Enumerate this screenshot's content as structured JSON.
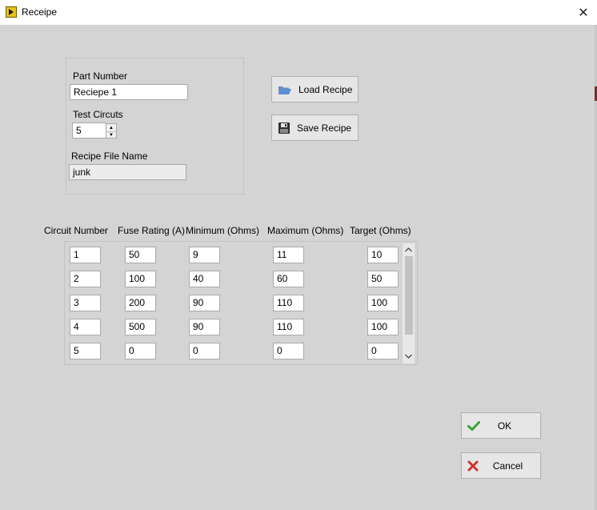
{
  "window": {
    "title": "Receipe",
    "close_glyph": "✕"
  },
  "part_number": {
    "label": "Part Number",
    "value": "Reciepe 1"
  },
  "test_circuits": {
    "label": "Test Circuts",
    "value": "5"
  },
  "recipe_file": {
    "label": "Recipe File Name",
    "value": "junk"
  },
  "buttons": {
    "load": "Load Recipe",
    "save": "Save Recipe",
    "ok": "OK",
    "cancel": "Cancel"
  },
  "table": {
    "headers": [
      "Circuit Number",
      "Fuse Rating (A)",
      "Minimum (Ohms)",
      "Maximum (Ohms)",
      "Target (Ohms)"
    ],
    "rows": [
      [
        "1",
        "50",
        "9",
        "11",
        "10"
      ],
      [
        "2",
        "100",
        "40",
        "60",
        "50"
      ],
      [
        "3",
        "200",
        "90",
        "110",
        "100"
      ],
      [
        "4",
        "500",
        "90",
        "110",
        "100"
      ],
      [
        "5",
        "0",
        "0",
        "0",
        "0"
      ]
    ]
  },
  "icons": {
    "app": "labview-icon",
    "load": "folder-open-icon",
    "save": "floppy-disk-icon",
    "ok": "check-icon",
    "cancel": "x-icon"
  },
  "colors": {
    "ok_check": "#3aa335",
    "cancel_x": "#d0342c",
    "folder": "#5b8ed6"
  }
}
